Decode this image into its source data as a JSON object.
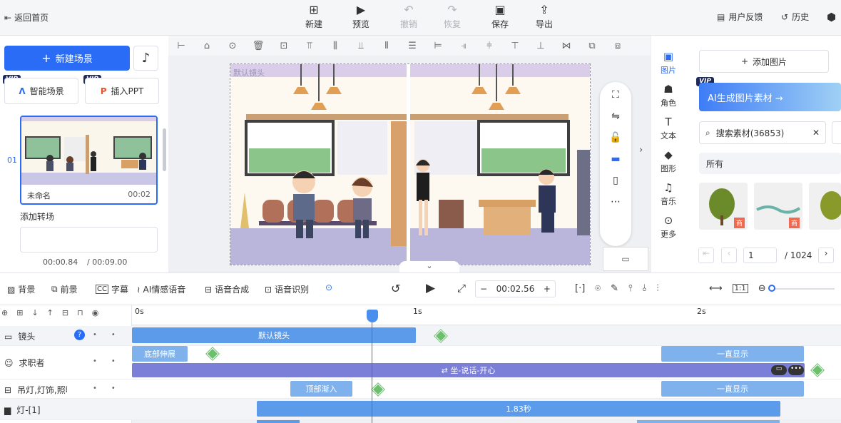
{
  "topbar": {
    "back": "返回首页",
    "new": "新建",
    "preview": "预览",
    "undo": "撤销",
    "redo": "恢复",
    "save": "保存",
    "export": "导出",
    "feedback": "用户反馈",
    "history": "历史"
  },
  "left": {
    "new_scene": "新建场景",
    "vip": "VIP",
    "smart_scene": "智能场景",
    "insert_ppt": "插入PPT",
    "scene_index": "01",
    "scene_name": "未命名",
    "scene_duration": "00:02",
    "add_transition": "添加转场",
    "time_current": "00:00.84",
    "time_total": "/ 00:09.00"
  },
  "stage": {
    "camera_label": "默认镜头"
  },
  "tabs": [
    "图片",
    "角色",
    "文本",
    "图形",
    "音乐",
    "更多"
  ],
  "right": {
    "add_image": "添加图片",
    "ai_banner": "AI生成图片素材 →",
    "search_placeholder": "搜索素材(36853)",
    "filter": "所有",
    "badge": "商",
    "page": "1",
    "page_total": "/ 1024"
  },
  "toolbar2": {
    "bg": "背景",
    "fg": "前景",
    "subtitle": "字幕",
    "ai_voice": "AI情感语音",
    "tts": "语音合成",
    "asr": "语音识别",
    "time": "00:02.56"
  },
  "ruler": {
    "t0": "0s",
    "t1": "1s",
    "t2": "2s"
  },
  "tracks": [
    {
      "label": "镜头"
    },
    {
      "label": "求职者"
    },
    {
      "label": "吊灯,灯饰,照明"
    },
    {
      "label": "灯-[1]"
    }
  ],
  "clips": {
    "camera": "默认镜头",
    "bottom_expand": "底部伸展",
    "always_show": "一直显示",
    "sit_talk": "⇄ 坐-说话-开心",
    "top_enter": "顶部渐入",
    "lamp_duration": "1.83秒"
  },
  "colors": {
    "accent": "#2a6cf6",
    "clip": "#5b9bea",
    "clip_purple": "#7b7fd8",
    "playhead": "#e0383e"
  }
}
